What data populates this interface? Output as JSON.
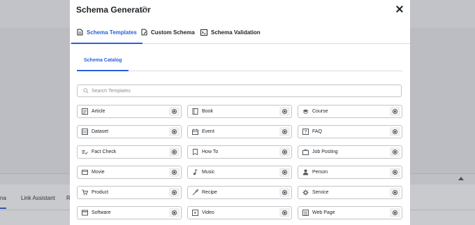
{
  "background": {
    "tabs": [
      "na",
      "Link Assistant",
      "Re"
    ]
  },
  "modal": {
    "title": "Schema Generator",
    "help_icon": "?",
    "tabs": [
      {
        "label": "Schema Templates",
        "icon": "document-icon",
        "active": true
      },
      {
        "label": "Custom Schema",
        "icon": "file-edit-icon",
        "active": false
      },
      {
        "label": "Schema Validation",
        "icon": "terminal-icon",
        "active": false
      }
    ],
    "subtab": "Schema Catalog",
    "search": {
      "placeholder": "Search Templates",
      "value": ""
    },
    "templates": [
      {
        "label": "Article",
        "icon": "article-icon"
      },
      {
        "label": "Book",
        "icon": "book-icon"
      },
      {
        "label": "Course",
        "icon": "graduation-cap-icon"
      },
      {
        "label": "Dataset",
        "icon": "dataset-icon"
      },
      {
        "label": "Event",
        "icon": "event-icon"
      },
      {
        "label": "FAQ",
        "icon": "faq-icon"
      },
      {
        "label": "Fact Check",
        "icon": "fact-check-icon"
      },
      {
        "label": "How To",
        "icon": "how-to-icon"
      },
      {
        "label": "Job Posting",
        "icon": "briefcase-icon"
      },
      {
        "label": "Movie",
        "icon": "movie-icon"
      },
      {
        "label": "Music",
        "icon": "music-note-icon"
      },
      {
        "label": "Person",
        "icon": "person-icon"
      },
      {
        "label": "Product",
        "icon": "cart-icon"
      },
      {
        "label": "Recipe",
        "icon": "recipe-icon"
      },
      {
        "label": "Service",
        "icon": "service-gear-icon"
      },
      {
        "label": "Software",
        "icon": "software-window-icon"
      },
      {
        "label": "Video",
        "icon": "video-icon"
      },
      {
        "label": "Web Page",
        "icon": "web-page-icon"
      }
    ]
  },
  "colors": {
    "accent": "#2b5fd9",
    "text": "#1d2327",
    "border": "#c3c4c7"
  }
}
